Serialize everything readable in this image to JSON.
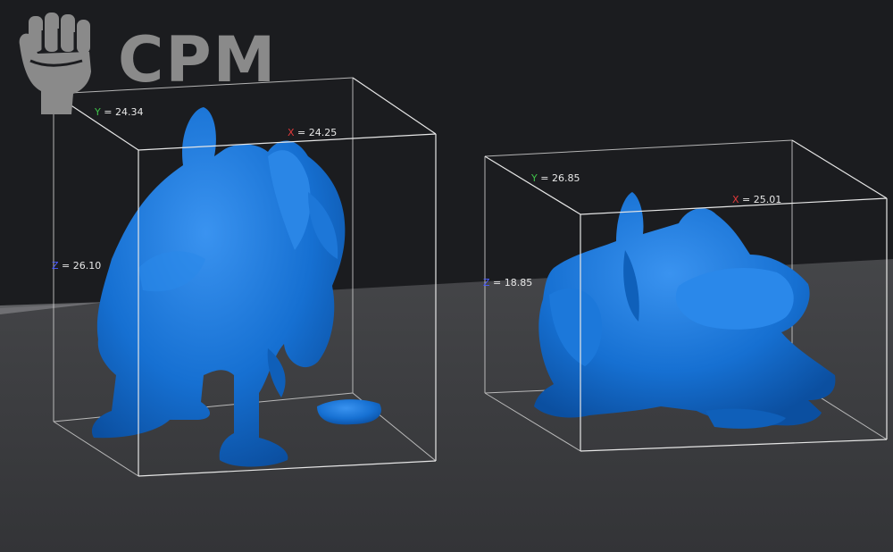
{
  "brand": {
    "logo_text": "CPM",
    "logo_icon": "raised-fist-icon"
  },
  "colors": {
    "background": "#1b1c1f",
    "floor": "#3c3d40",
    "model": "#1673d6",
    "bbox_lines": "#d9d9d9",
    "axis_x": "#e0393a",
    "axis_y": "#3fc24a",
    "axis_z": "#4a5cff"
  },
  "models": [
    {
      "name": "creature-standing",
      "dims": {
        "x": {
          "axis": "X",
          "eq": " = ",
          "value": "24.25"
        },
        "y": {
          "axis": "Y",
          "eq": " = ",
          "value": "24.34"
        },
        "z": {
          "axis": "Z",
          "eq": " = ",
          "value": "26.10"
        }
      }
    },
    {
      "name": "creature-crouching",
      "dims": {
        "x": {
          "axis": "X",
          "eq": " = ",
          "value": "25.01"
        },
        "y": {
          "axis": "Y",
          "eq": " = ",
          "value": "26.85"
        },
        "z": {
          "axis": "Z",
          "eq": " = ",
          "value": "18.85"
        }
      }
    }
  ]
}
